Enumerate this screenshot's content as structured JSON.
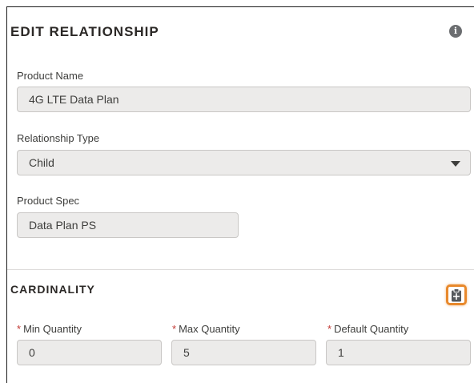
{
  "header": {
    "title": "EDIT RELATIONSHIP",
    "info_icon": "info-icon"
  },
  "fields": {
    "product_name": {
      "label": "Product Name",
      "value": "4G LTE Data Plan"
    },
    "relationship_type": {
      "label": "Relationship Type",
      "value": "Child",
      "icon": "chevron-down-icon"
    },
    "product_spec": {
      "label": "Product Spec",
      "value": "Data Plan PS"
    }
  },
  "cardinality": {
    "title": "CARDINALITY",
    "action_icon": "clipboard-add-icon",
    "required_marker": "*",
    "min": {
      "label": "Min Quantity",
      "value": "0"
    },
    "max": {
      "label": "Max Quantity",
      "value": "5"
    },
    "default": {
      "label": "Default Quantity",
      "value": "1"
    }
  },
  "colors": {
    "highlight": "#e8892c",
    "required": "#c23934",
    "field_bg": "#ecebea"
  }
}
